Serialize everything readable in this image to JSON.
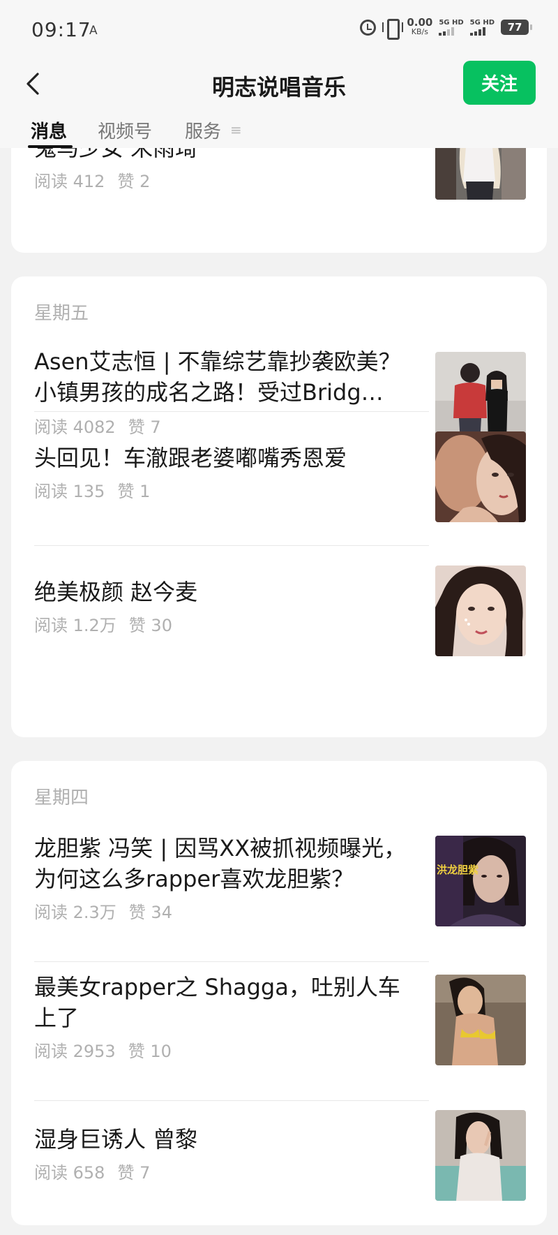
{
  "status": {
    "time": "09:17",
    "a_icon": "A",
    "speed_num": "0.00",
    "speed_unit": "KB/s",
    "sim1": "5G HD",
    "sim2": "5G HD",
    "battery": "77"
  },
  "header": {
    "title": "明志说唱音乐",
    "follow": "关注"
  },
  "tabs": [
    "消息",
    "视频号",
    "服务"
  ],
  "tab_more": "≡",
  "cards": [
    {
      "day": "",
      "articles": [
        {
          "title": "鬼马少女 宋雨琦",
          "read": "阅读 412",
          "like": "赞 2"
        }
      ]
    },
    {
      "day": "星期五",
      "articles": [
        {
          "title": "Asen艾志恒 | 不靠综艺靠抄袭欧美？小镇男孩的成名之路！受过Bridg…",
          "read": "阅读 4082",
          "like": "赞 7"
        },
        {
          "title": "头回见！车澈跟老婆嘟嘴秀恩爱",
          "read": "阅读 135",
          "like": "赞 1"
        },
        {
          "title": "绝美极颜  赵今麦",
          "read": "阅读 1.2万",
          "like": "赞 30"
        }
      ]
    },
    {
      "day": "星期四",
      "articles": [
        {
          "title": "龙胆紫 冯笑 | 因骂XX被抓视频曝光，为何这么多rapper喜欢龙胆紫？",
          "read": "阅读 2.3万",
          "like": "赞 34"
        },
        {
          "title": "最美女rapper之 Shagga，吐别人车上了",
          "read": "阅读 2953",
          "like": "赞 10"
        },
        {
          "title": "湿身巨诱人  曾黎",
          "read": "阅读 658",
          "like": "赞 7"
        }
      ]
    }
  ],
  "thumb_text": "洪龙胆紫",
  "colors": {
    "accent": "#07c160",
    "muted": "#b0b0b0",
    "background": "#f2f2f2"
  }
}
